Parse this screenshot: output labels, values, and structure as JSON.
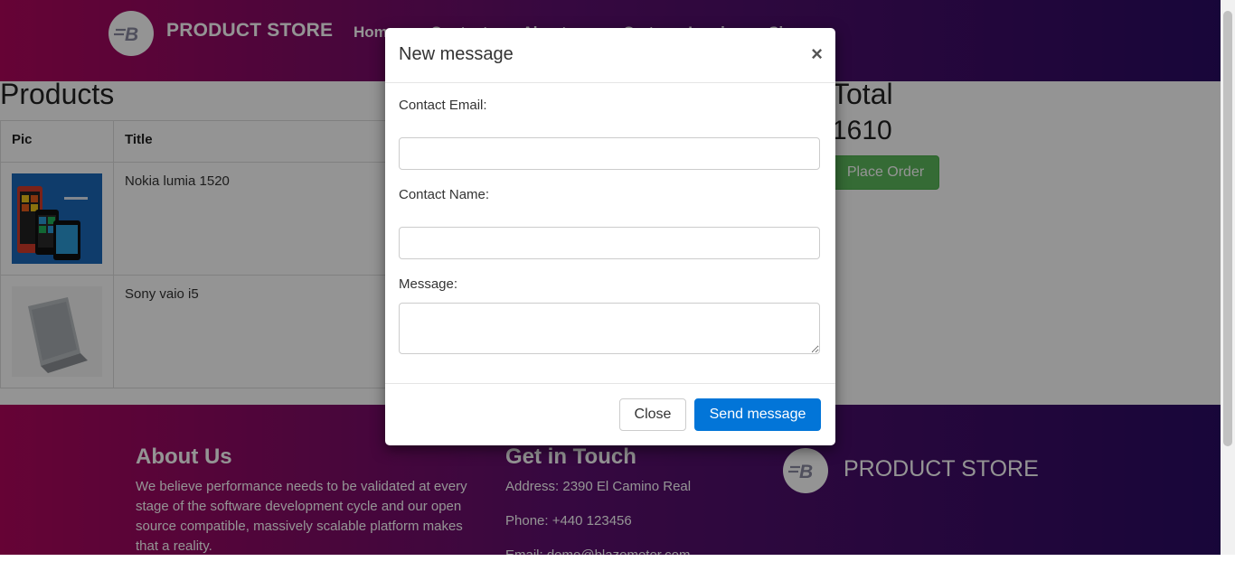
{
  "navbar": {
    "brand": "PRODUCT STORE",
    "links": [
      "Home",
      "Contact",
      "About us",
      "Cart",
      "Log in",
      "Sign up"
    ]
  },
  "products": {
    "title": "Products",
    "columns": [
      "Pic",
      "Title"
    ],
    "rows": [
      {
        "title": "Nokia lumia 1520",
        "image": "nokia-phone-image"
      },
      {
        "title": "Sony vaio i5",
        "image": "sony-laptop-image"
      }
    ]
  },
  "total": {
    "label": "Total",
    "value": "1610",
    "place_order": "Place Order"
  },
  "modal": {
    "title": "New message",
    "close_symbol": "×",
    "email_label": "Contact Email:",
    "name_label": "Contact Name:",
    "message_label": "Message:",
    "email_value": "",
    "name_value": "",
    "message_value": "",
    "close_button": "Close",
    "send_button": "Send message"
  },
  "footer": {
    "about_title": "About Us",
    "about_text": "We believe performance needs to be validated at every stage of the software development cycle and our open source compatible, massively scalable platform makes that a reality.",
    "touch_title": "Get in Touch",
    "address": "Address: 2390 El Camino Real",
    "phone": "Phone: +440 123456",
    "email": "Email: demo@blazemeter.com",
    "brand": "PRODUCT STORE"
  },
  "colors": {
    "gradient_start": "#b0065c",
    "gradient_end": "#290b63",
    "send_button": "#0275d8",
    "place_order": "#5cb85c"
  }
}
